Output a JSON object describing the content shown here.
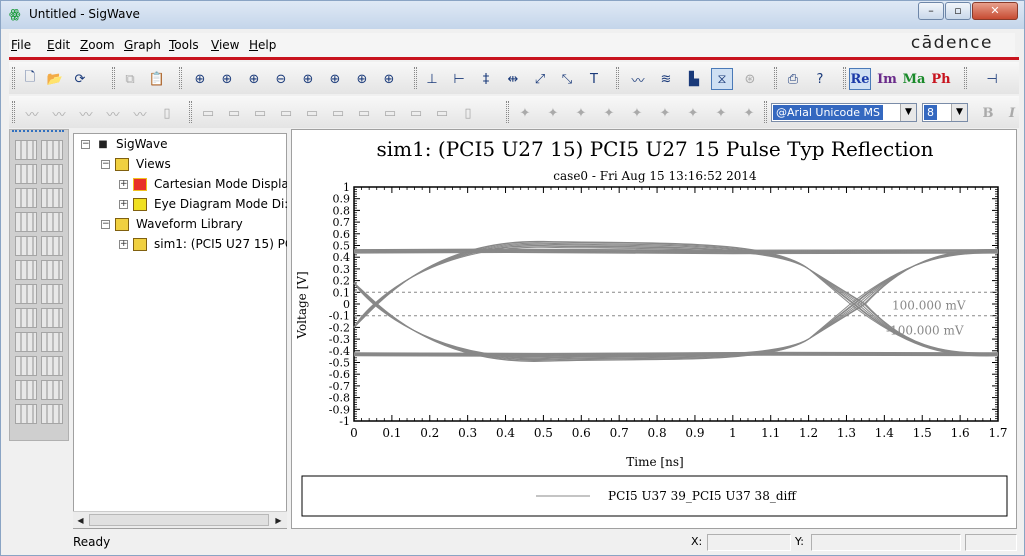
{
  "window": {
    "title": "Untitled - SigWave",
    "app_icon_glyph": "ꙮ"
  },
  "window_buttons": {
    "minimize": "–",
    "maximize": "▫",
    "close": "✕"
  },
  "menu": {
    "items": [
      {
        "label": "File",
        "mnemonic": "F",
        "rest": "ile"
      },
      {
        "label": "Edit",
        "mnemonic": "E",
        "rest": "dit"
      },
      {
        "label": "Zoom",
        "mnemonic": "Z",
        "rest": "oom"
      },
      {
        "label": "Graph",
        "mnemonic": "G",
        "rest": "raph"
      },
      {
        "label": "Tools",
        "mnemonic": "T",
        "rest": "ools"
      },
      {
        "label": "View",
        "mnemonic": "V",
        "rest": "iew"
      },
      {
        "label": "Help",
        "mnemonic": "H",
        "rest": "elp"
      }
    ],
    "brand": "cādence"
  },
  "toolbar1": {
    "file": [
      {
        "name": "new-file-icon",
        "glyph": "🗋"
      },
      {
        "name": "open-folder-icon",
        "glyph": "📂"
      },
      {
        "name": "refresh-icon",
        "glyph": "⟳"
      }
    ],
    "clipboard": [
      {
        "name": "copy-icon",
        "glyph": "⧉"
      },
      {
        "name": "paste-icon",
        "glyph": "📋"
      }
    ],
    "zoom": [
      {
        "name": "zoom-fit-icon",
        "glyph": "⊕"
      },
      {
        "name": "zoom-area-icon",
        "glyph": "⊕"
      },
      {
        "name": "zoom-in-icon",
        "glyph": "⊕"
      },
      {
        "name": "zoom-out-icon",
        "glyph": "⊖"
      },
      {
        "name": "zoom-x-icon",
        "glyph": "⊕"
      },
      {
        "name": "zoom-y-icon",
        "glyph": "⊕"
      },
      {
        "name": "zoom-1to1-icon",
        "glyph": "⊕"
      },
      {
        "name": "zoom-pan-icon",
        "glyph": "⊕"
      }
    ],
    "markers": [
      {
        "name": "marker-horizontal-icon",
        "glyph": "⊥"
      },
      {
        "name": "marker-vertical-icon",
        "glyph": "⊢"
      },
      {
        "name": "marker-delta-y-icon",
        "glyph": "‡"
      },
      {
        "name": "marker-delta-x-icon",
        "glyph": "⇹"
      },
      {
        "name": "marker-diagonal-icon",
        "glyph": "⤢"
      },
      {
        "name": "marker-slope-icon",
        "glyph": "⤡"
      },
      {
        "name": "text-annotation-icon",
        "glyph": "T"
      }
    ],
    "modes": [
      {
        "name": "cartesian-mode-icon",
        "glyph": "〰"
      },
      {
        "name": "multi-trace-icon",
        "glyph": "≋"
      },
      {
        "name": "histogram-icon",
        "glyph": "▙"
      },
      {
        "name": "eye-diagram-icon",
        "glyph": "⧖"
      },
      {
        "name": "polar-mode-icon",
        "glyph": "⊛"
      }
    ],
    "misc": [
      {
        "name": "print-icon",
        "glyph": "⎙"
      },
      {
        "name": "help-cursor-icon",
        "glyph": "?"
      }
    ],
    "complex": [
      {
        "label": "Re",
        "color": "#1a3aa8"
      },
      {
        "label": "Im",
        "color": "#6a2a8a"
      },
      {
        "label": "Ma",
        "color": "#1a8a2a"
      },
      {
        "label": "Ph",
        "color": "#c8141e"
      }
    ],
    "pin": {
      "name": "pin-icon",
      "glyph": "⊣"
    }
  },
  "toolbar2": {
    "font_name": "@Arial Unicode MS",
    "font_size": "8",
    "bold": "B",
    "italic": "I"
  },
  "tree": {
    "root": "SigWave",
    "views": "Views",
    "cartesian": "Cartesian Mode Displa",
    "eye": "Eye Diagram Mode Di:",
    "library": "Waveform Library",
    "sim": "sim1: (PCI5 U27 15) PC"
  },
  "graph": {
    "title": "sim1: (PCI5 U27 15) PCI5 U27 15 Pulse Typ Reflection",
    "subtitle": "case0 - Fri Aug 15 13:16:52 2014",
    "xlabel": "Time [ns]",
    "ylabel": "Voltage [V]",
    "legend_entry": "PCI5 U37 39_PCI5 U37 38_diff",
    "threshold_high_label": "100.000 mV",
    "threshold_low_label": "-100.000 mV",
    "series_color": "#888888"
  },
  "chart_data": {
    "type": "line",
    "title": "sim1: (PCI5 U27 15) PCI5 U27 15 Pulse Typ Reflection",
    "subtitle": "case0 - Fri Aug 15 13:16:52 2014",
    "xlabel": "Time [ns]",
    "ylabel": "Voltage [V]",
    "xlim": [
      0,
      1.7
    ],
    "ylim": [
      -1,
      1
    ],
    "xticks": [
      "0",
      "0.1",
      "0.2",
      "0.3",
      "0.4",
      "0.5",
      "0.6",
      "0.7",
      "0.8",
      "0.9",
      "1",
      "1.1",
      "1.2",
      "1.3",
      "1.4",
      "1.5",
      "1.6",
      "1.7"
    ],
    "yticks": [
      "1",
      "0.9",
      "0.8",
      "0.7",
      "0.6",
      "0.5",
      "0.4",
      "0.3",
      "0.2",
      "0.1",
      "0",
      "-0.1",
      "-0.2",
      "-0.3",
      "-0.4",
      "-0.5",
      "-0.6",
      "-0.7",
      "-0.8",
      "-0.9",
      "-1"
    ],
    "thresholds": [
      0.1,
      -0.1
    ],
    "legend": [
      "PCI5 U37 39_PCI5 U37 38_diff"
    ],
    "eye": {
      "high_level": 0.45,
      "low_level": -0.43,
      "crossings_ns": [
        0.05,
        1.33
      ],
      "peak_overshoot": 0.53,
      "peak_undershoot": -0.5
    }
  },
  "status": {
    "ready": "Ready",
    "x_label": "X:",
    "y_label": "Y:"
  }
}
